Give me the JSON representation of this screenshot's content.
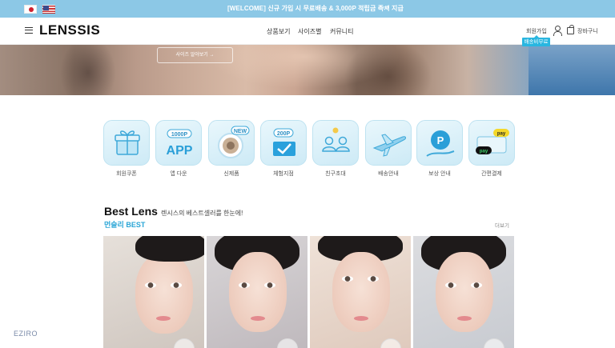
{
  "topbar": {
    "flags": [
      "japan-flag",
      "usa-flag"
    ],
    "promo_text": "[WELCOME] 신규 가입 시 무료배송 & 3,000P 적립금 즉시 지급",
    "promo_arrow": "⟶"
  },
  "header": {
    "logo": "LENSSIS",
    "nav": [
      "상품보기",
      "사이즈별",
      "커뮤니티"
    ],
    "signup_label": "회원가입",
    "signup_badge": "배송비무료",
    "cart_label": "장바구니"
  },
  "hero": {
    "button_label": "사이즈 알아보기 →"
  },
  "quick_menu": [
    {
      "label": "회원쿠폰",
      "icon": "gift-box-icon"
    },
    {
      "label": "앱 다운",
      "icon": "app-1000p-icon",
      "badge": "1000P",
      "text": "APP"
    },
    {
      "label": "신제품",
      "icon": "new-lens-icon",
      "badge": "NEW"
    },
    {
      "label": "체험지점",
      "icon": "checkmark-200p-icon",
      "badge": "200P"
    },
    {
      "label": "친구초대",
      "icon": "friends-icon"
    },
    {
      "label": "배송안내",
      "icon": "airplane-icon"
    },
    {
      "label": "보상 안내",
      "icon": "points-icon",
      "text": "P"
    },
    {
      "label": "간편결제",
      "icon": "pay-cards-icon",
      "badge": "pay",
      "text": "pay"
    }
  ],
  "best": {
    "title": "Best Lens",
    "subtitle": "렌시스의 베스트셀러를 한눈에!",
    "tab": "먼슬리 BEST",
    "more": "더보기"
  },
  "watermark": "EZIRO"
}
